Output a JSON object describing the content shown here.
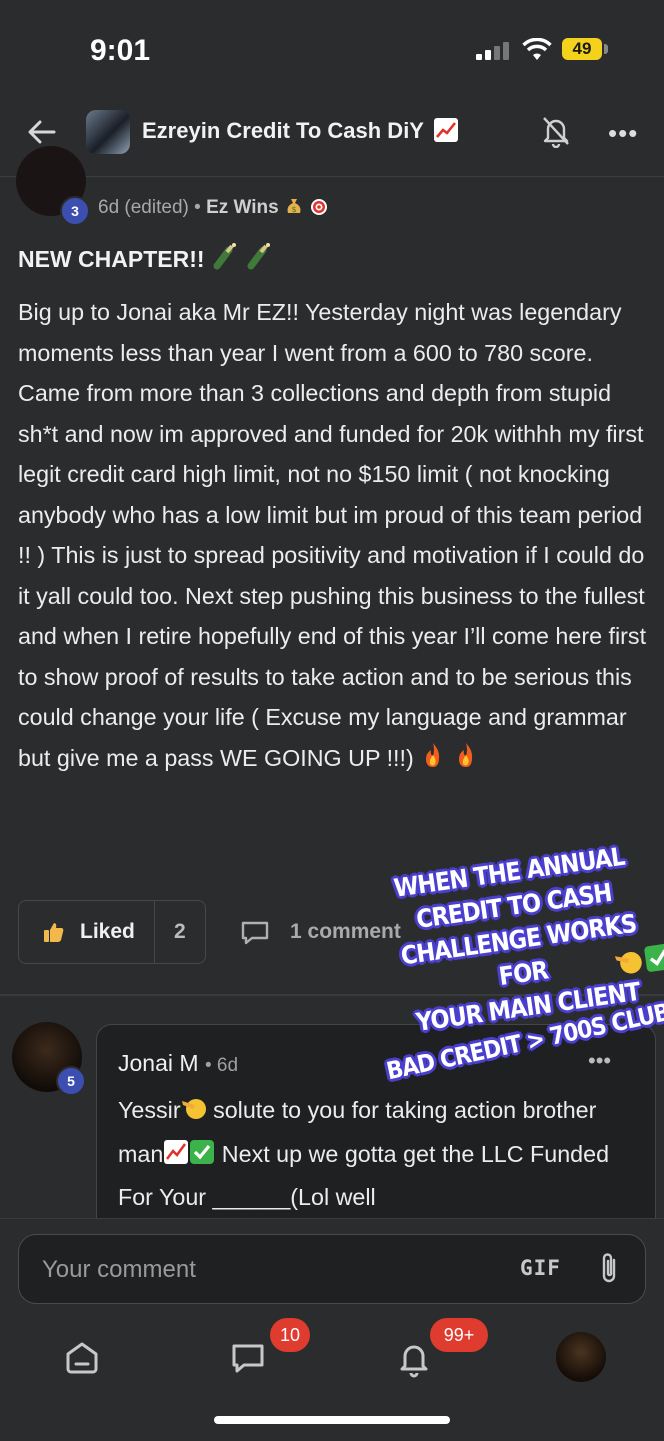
{
  "status_bar": {
    "time": "9:01",
    "battery": "49"
  },
  "header": {
    "title": "Ezreyin Credit To Cash DiY"
  },
  "post": {
    "author_level": "3",
    "meta_time": "6d (edited)",
    "meta_category": "Ez Wins",
    "title": "NEW CHAPTER!!",
    "body": "Big up to Jonai aka Mr EZ!! Yesterday night was legendary moments less than year I went from a 600 to 780 score. Came from more than 3 collections and depth from stupid sh*t and now im approved and funded for 20k withhh my first legit credit card high limit, not no $150 limit ( not knocking anybody who has a low limit but im proud of this team period !! ) This is just to spread positivity and motivation if I could do it yall could too. Next step pushing this business to the fullest and when I retire hopefully end of this year I’ll come here first to show proof of results to take action and to be serious this could change your life ( Excuse my language and grammar but give me a pass WE GOING UP !!!)",
    "liked_label": "Liked",
    "like_count": "2",
    "comment_count": "1 comment"
  },
  "comment": {
    "author": "Jonai M",
    "author_level": "5",
    "time": "6d",
    "text_1": "Yessir",
    "text_2": " solute to you for taking action brother man",
    "text_3": " Next up we gotta get the LLC Funded For Your ______(Lol well"
  },
  "overlay": {
    "caption_1": "WHEN THE ANNUAL\nCREDIT TO CASH\nCHALLENGE WORKS FOR\nYOUR MAIN CLIENT",
    "caption_2": "BAD CREDIT > 700S CLUB"
  },
  "composer": {
    "placeholder": "Your comment",
    "gif_label": "GIF"
  },
  "nav": {
    "chat_badge": "10",
    "notifications_badge": "99+"
  },
  "colors": {
    "background": "#2b2c2e",
    "badge": "#e03b2f",
    "level": "#3c4fb0",
    "caption_outline": "#4a3fcf"
  }
}
